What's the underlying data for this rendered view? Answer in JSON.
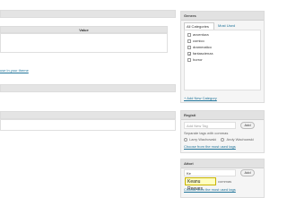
{
  "left": {
    "value_column": "Value",
    "link_text": "use in your theme"
  },
  "genres": {
    "title": "Genres",
    "tabs": [
      "All Categories",
      "Most Used"
    ],
    "items": [
      {
        "label": "avventura",
        "checked": false
      },
      {
        "label": "comico",
        "checked": false
      },
      {
        "label": "drammatico",
        "checked": false
      },
      {
        "label": "fantascienza",
        "checked": true
      },
      {
        "label": "horror",
        "checked": false
      }
    ],
    "add_link": "+ Add New Category"
  },
  "registi": {
    "title": "Registi",
    "input_placeholder": "Add New Tag",
    "add_label": "Add",
    "separate_note": "Separate tags with commas",
    "tags": [
      "Larry Wachowski",
      "Andy Wachowski"
    ],
    "choose_link": "Choose from the most used tags"
  },
  "attori": {
    "title": "Attori",
    "input_value": "Ke",
    "add_label": "Add",
    "suggestion": "Keanu Reeves",
    "note_tail": "commas",
    "choose_link": "Choose from the most used tags"
  }
}
